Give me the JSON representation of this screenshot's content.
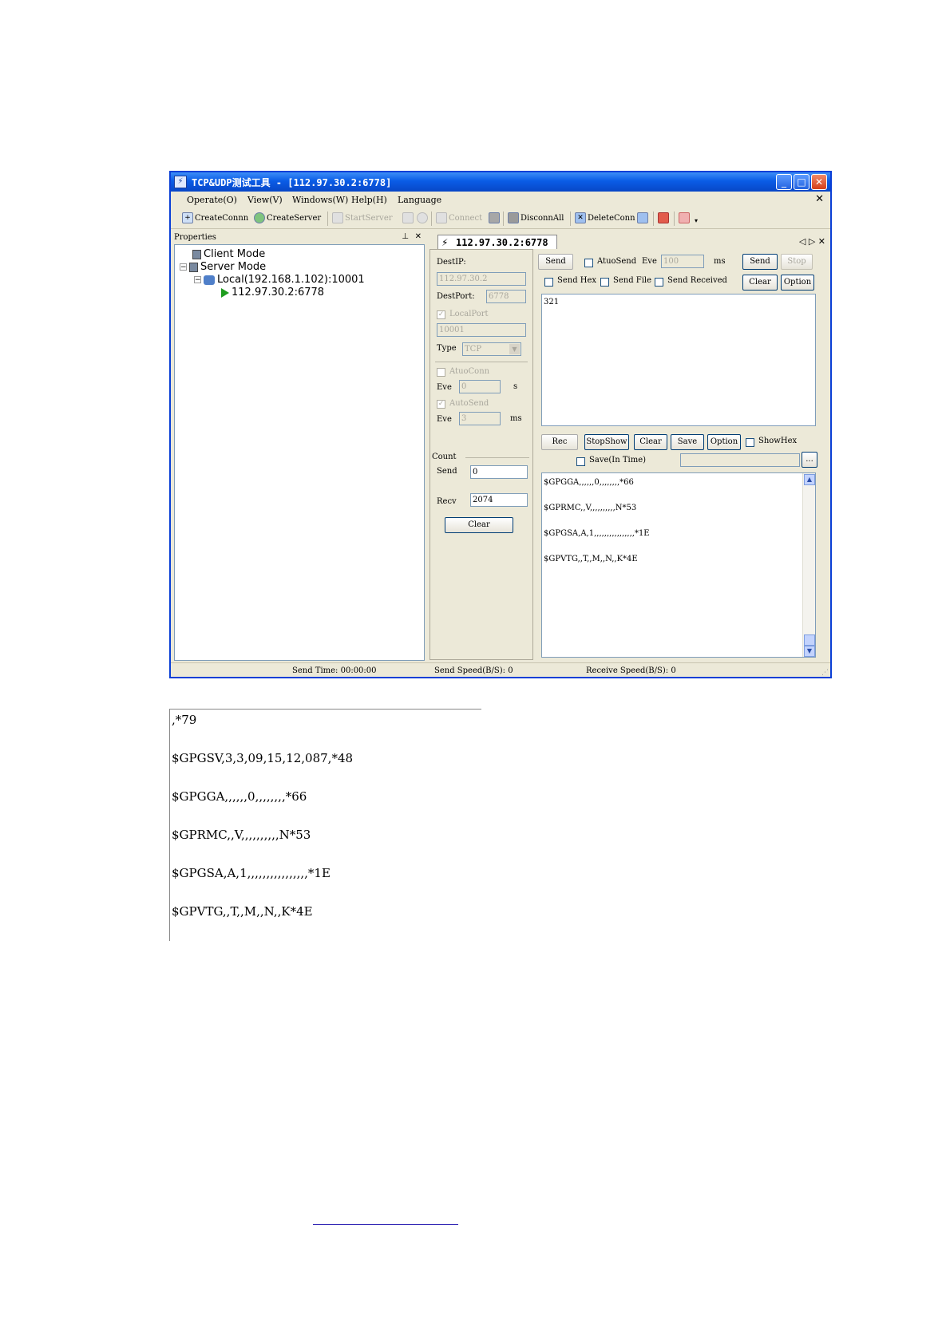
{
  "window": {
    "title": "TCP&UDP测试工具 - [112.97.30.2:6778]",
    "icon": "app-icon",
    "controls": [
      "_",
      "□",
      "✕"
    ]
  },
  "menu": {
    "items": [
      "Operate(O)",
      "View(V)",
      "Windows(W)",
      "Help(H)",
      "Language"
    ],
    "close": "✕"
  },
  "toolbar": {
    "create_conn": "CreateConnn",
    "create_server": "CreateServer",
    "start_server": "StartServer",
    "connect": "Connect",
    "disconn_all": "DisconnAll",
    "delete_conn": "DeleteConn"
  },
  "properties": {
    "header": "Properties",
    "pin": "⊥",
    "close": "✕",
    "tree": {
      "client_mode": "Client Mode",
      "server_mode": "Server Mode",
      "local": "Local(192.168.1.102):10001",
      "remote": "112.97.30.2:6778"
    }
  },
  "tab": {
    "label": "112.97.30.2:6778",
    "nav": "◁ ▷ ✕"
  },
  "connection": {
    "dest_ip_label": "DestIP:",
    "dest_ip": "112.97.30.2",
    "dest_port_label": "DestPort:",
    "dest_port": "6778",
    "local_port_label": "LocalPort",
    "local_port": "10001",
    "type_label": "Type",
    "type_value": "TCP",
    "auto_conn_label": "AtuoConn",
    "eve_label": "Eve",
    "eve_conn": "0",
    "s_unit": "s",
    "auto_send_label": "AutoSend",
    "eve_send": "3",
    "ms_unit": "ms",
    "count_label": "Count",
    "send_label": "Send",
    "send_count": "0",
    "recv_label": "Recv",
    "recv_count": "2074",
    "clear_button": "Clear"
  },
  "send_area": {
    "send_tab": "Send",
    "auto_send": "AtuoSend",
    "eve_label": "Eve",
    "eve_value": "100",
    "ms_unit": "ms",
    "send_button": "Send",
    "stop_button": "Stop",
    "send_hex": "Send Hex",
    "send_file": "Send File",
    "send_received": "Send Received",
    "clear_button": "Clear",
    "option_button": "Option",
    "content": "321"
  },
  "recv_area": {
    "rec_tab": "Rec",
    "stop_show": "StopShow",
    "clear_button": "Clear",
    "save_button": "Save",
    "option_button": "Option",
    "show_hex": "ShowHex",
    "save_in_time": "Save(In Time)",
    "browse_button": "...",
    "lines": [
      "$GPGGA,,,,,,0,,,,,,,,*66",
      "$GPRMC,,V,,,,,,,,,,N*53",
      "$GPGSA,A,1,,,,,,,,,,,,,,,,*1E",
      "$GPVTG,,T,,M,,N,,K*4E"
    ]
  },
  "status": {
    "send_time": "Send Time: 00:00:00",
    "send_speed": "Send Speed(B/S): 0",
    "receive_speed": "Receive Speed(B/S): 0"
  },
  "second_capture": {
    "lines": [
      ",*79",
      "$GPGSV,3,3,09,15,12,087,*48",
      "$GPGGA,,,,,,0,,,,,,,,*66",
      "$GPRMC,,V,,,,,,,,,,N*53",
      "$GPGSA,A,1,,,,,,,,,,,,,,,,*1E",
      "$GPVTG,,T,,M,,N,,K*4E"
    ]
  },
  "colors": {
    "titlebar": "#0a5ce6",
    "window_bg": "#ece9d8",
    "play_icon": "#1f9d1f",
    "link": "#1a0dab"
  }
}
